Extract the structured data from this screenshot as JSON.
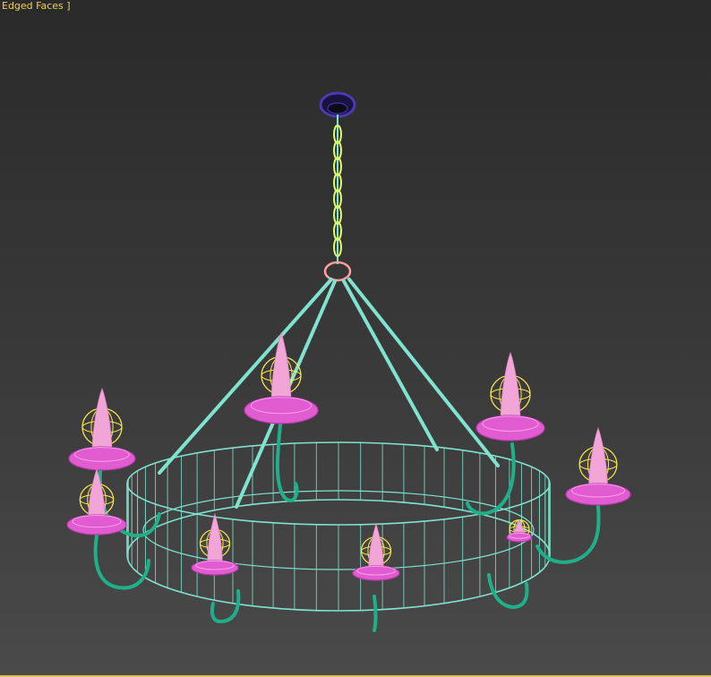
{
  "viewport": {
    "label": "Edged Faces ]"
  },
  "scene": {
    "object": "chandelier",
    "candle_count": 9,
    "colors": {
      "background_top": "#2a2a2a",
      "background_bottom": "#4a4a4a",
      "label": "#f2d24a",
      "wire": "#7fe3cf",
      "arm": "#1fb08a",
      "chain": "#d9ff66",
      "canopy": "#2a1f6a",
      "candle": "#f2a6d8",
      "cup": "#e05cd0",
      "bulb_cage": "#ffe94a"
    }
  }
}
